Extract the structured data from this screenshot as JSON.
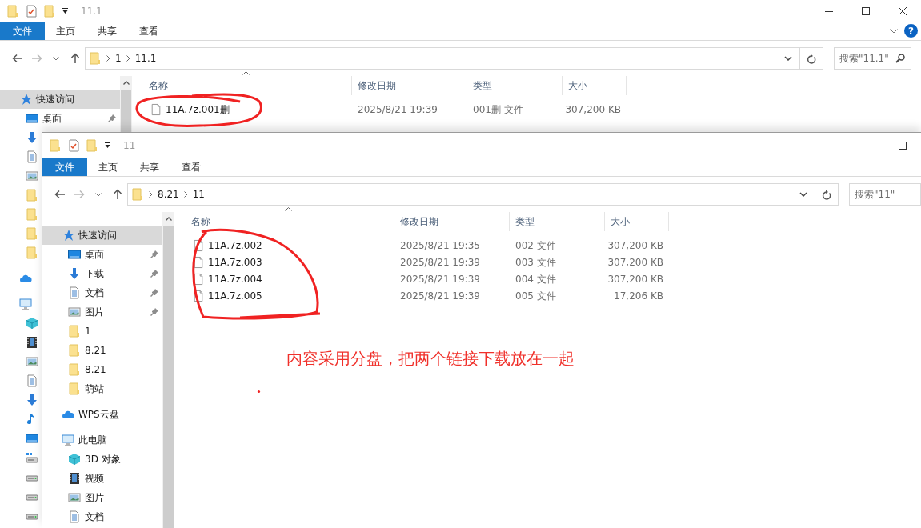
{
  "back_window": {
    "title": "11.1",
    "ribbon_tabs": [
      {
        "label": "文件",
        "kind": "file"
      },
      {
        "label": "主页",
        "kind": "tab"
      },
      {
        "label": "共享",
        "kind": "tab"
      },
      {
        "label": "查看",
        "kind": "tab"
      }
    ],
    "help": "?",
    "path": [
      "1",
      "11.1"
    ],
    "search_placeholder": "搜索\"11.1\"",
    "sidebar": [
      {
        "label": "快速访问",
        "kind": "star",
        "selected": true,
        "children": [
          {
            "label": "桌面",
            "kind": "desktop",
            "pinned": true
          },
          {
            "kind": "download"
          },
          {
            "kind": "document"
          },
          {
            "kind": "picture"
          },
          {
            "kind": "folder"
          },
          {
            "kind": "folder"
          },
          {
            "kind": "folder"
          },
          {
            "kind": "folder"
          }
        ]
      },
      {
        "kind": "cloud",
        "selected": false
      },
      {
        "kind": "pc",
        "selected": false,
        "children": [
          {
            "kind": "cube"
          },
          {
            "kind": "video"
          },
          {
            "kind": "picture"
          },
          {
            "kind": "document"
          },
          {
            "kind": "download"
          },
          {
            "kind": "music"
          },
          {
            "kind": "desktop"
          },
          {
            "kind": "netdrive"
          },
          {
            "kind": "drive"
          },
          {
            "kind": "drive"
          },
          {
            "kind": "drive"
          }
        ]
      }
    ],
    "columns": [
      "名称",
      "修改日期",
      "类型",
      "大小"
    ],
    "files": [
      {
        "name": "11A.7z.001删",
        "modified": "2025/8/21 19:39",
        "type": "001删 文件",
        "size": "307,200 KB"
      }
    ]
  },
  "front_window": {
    "title": "11",
    "ribbon_tabs": [
      {
        "label": "文件",
        "kind": "file"
      },
      {
        "label": "主页",
        "kind": "tab"
      },
      {
        "label": "共享",
        "kind": "tab"
      },
      {
        "label": "查看",
        "kind": "tab"
      }
    ],
    "path": [
      "8.21",
      "11"
    ],
    "search_placeholder": "搜索\"11\"",
    "sidebar": [
      {
        "label": "快速访问",
        "kind": "star",
        "selected": true,
        "children": [
          {
            "label": "桌面",
            "kind": "desktop",
            "pinned": true
          },
          {
            "label": "下载",
            "kind": "download",
            "pinned": true
          },
          {
            "label": "文档",
            "kind": "document",
            "pinned": true
          },
          {
            "label": "图片",
            "kind": "picture",
            "pinned": true
          },
          {
            "label": "1",
            "kind": "folder",
            "pinned": false
          },
          {
            "label": "8.21",
            "kind": "folder",
            "pinned": false
          },
          {
            "label": "8.21",
            "kind": "folder",
            "pinned": false
          },
          {
            "label": "萌站",
            "kind": "folder",
            "pinned": false
          }
        ]
      },
      {
        "label": "WPS云盘",
        "kind": "cloud",
        "selected": false
      },
      {
        "label": "此电脑",
        "kind": "pc",
        "selected": false,
        "children": [
          {
            "label": "3D 对象",
            "kind": "cube",
            "pinned": false
          },
          {
            "label": "视频",
            "kind": "video",
            "pinned": false
          },
          {
            "label": "图片",
            "kind": "picture",
            "pinned": false
          },
          {
            "label": "文档",
            "kind": "document",
            "pinned": false
          }
        ]
      }
    ],
    "columns": [
      "名称",
      "修改日期",
      "类型",
      "大小"
    ],
    "files": [
      {
        "name": "11A.7z.002",
        "modified": "2025/8/21 19:35",
        "type": "002 文件",
        "size": "307,200 KB"
      },
      {
        "name": "11A.7z.003",
        "modified": "2025/8/21 19:39",
        "type": "003 文件",
        "size": "307,200 KB"
      },
      {
        "name": "11A.7z.004",
        "modified": "2025/8/21 19:39",
        "type": "004 文件",
        "size": "307,200 KB"
      },
      {
        "name": "11A.7z.005",
        "modified": "2025/8/21 19:39",
        "type": "005 文件",
        "size": "17,206 KB"
      }
    ]
  },
  "annotation": {
    "text": "内容采用分盘，把两个链接下载放在一起"
  }
}
